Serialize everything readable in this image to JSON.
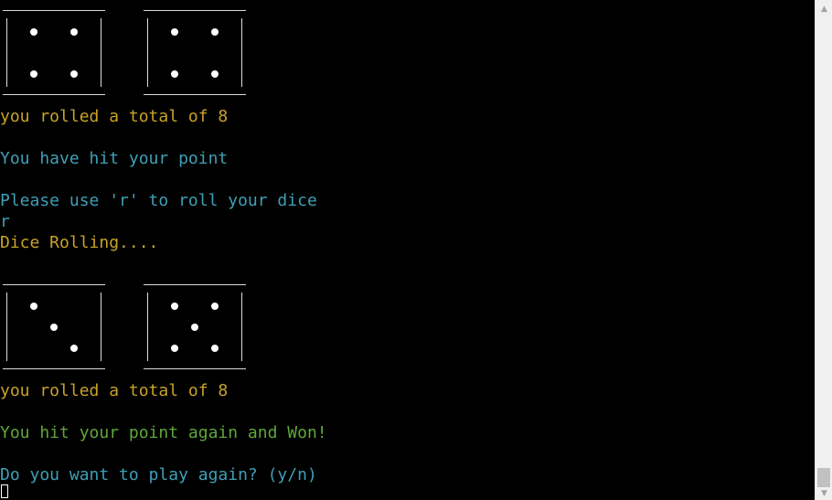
{
  "colors": {
    "background": "#000000",
    "roll_text": "#c9a227",
    "prompt_text": "#3ea0b6",
    "win_text": "#5fa73a",
    "input_text": "#3ea0b6",
    "die_pip": "#ffffff",
    "die_frame": "#dcdcdc"
  },
  "terminal": {
    "first_roll": {
      "dice": [
        4,
        4
      ],
      "total_message": "you rolled a total of 8"
    },
    "point_message": "You have hit your point",
    "roll_prompt": "Please use 'r' to roll your dice",
    "user_input": "r",
    "rolling_message": "Dice Rolling....",
    "second_roll": {
      "dice": [
        3,
        5
      ],
      "total_message": "you rolled a total of 8"
    },
    "win_message": "You hit your point again and Won!",
    "play_again_prompt": "Do you want to play again? (y/n)"
  },
  "scrollbar": {
    "up_icon": "triangle-up-icon",
    "down_icon": "triangle-down-icon"
  }
}
